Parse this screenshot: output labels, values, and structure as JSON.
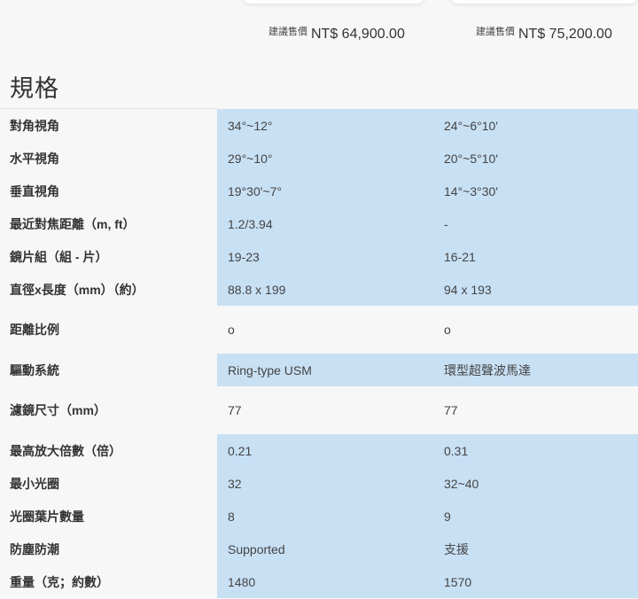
{
  "products": [
    {
      "price_label": "建議售價",
      "price": "NT$ 64,900.00"
    },
    {
      "price_label": "建議售價",
      "price": "NT$ 75,200.00"
    }
  ],
  "section_title": "規格",
  "specs": [
    {
      "label": "對角視角",
      "v1": "34°~12°",
      "v2": "24°~6°10'"
    },
    {
      "label": "水平視角",
      "v1": "29°~10°",
      "v2": "20°~5°10'"
    },
    {
      "label": "垂直視角",
      "v1": "19°30'~7°",
      "v2": "14°~3°30'"
    },
    {
      "label": "最近對焦距離（m, ft）",
      "v1": "1.2/3.94",
      "v2": "-"
    },
    {
      "label": "鏡片組（組 - 片）",
      "v1": "19-23",
      "v2": "16-21"
    },
    {
      "label": "直徑x長度（mm）（約）",
      "v1": "88.8 x 199",
      "v2": "94 x 193"
    },
    {
      "label": "距離比例",
      "v1": "o",
      "v2": "o"
    },
    {
      "label": "驅動系統",
      "v1": "Ring-type USM",
      "v2": "環型超聲波馬達"
    },
    {
      "label": "濾鏡尺寸（mm）",
      "v1": "77",
      "v2": "77"
    },
    {
      "label": "最高放大倍數（倍）",
      "v1": "0.21",
      "v2": "0.31"
    },
    {
      "label": "最小光圈",
      "v1": "32",
      "v2": "32~40"
    },
    {
      "label": "光圈葉片數量",
      "v1": "8",
      "v2": "9"
    },
    {
      "label": "防塵防潮",
      "v1": "Supported",
      "v2": "支援"
    },
    {
      "label": "重量（克；約數）",
      "v1": "1480",
      "v2": "1570"
    }
  ],
  "colors": {
    "highlight": "#c8e0f4",
    "background": "#f7f7f7"
  }
}
